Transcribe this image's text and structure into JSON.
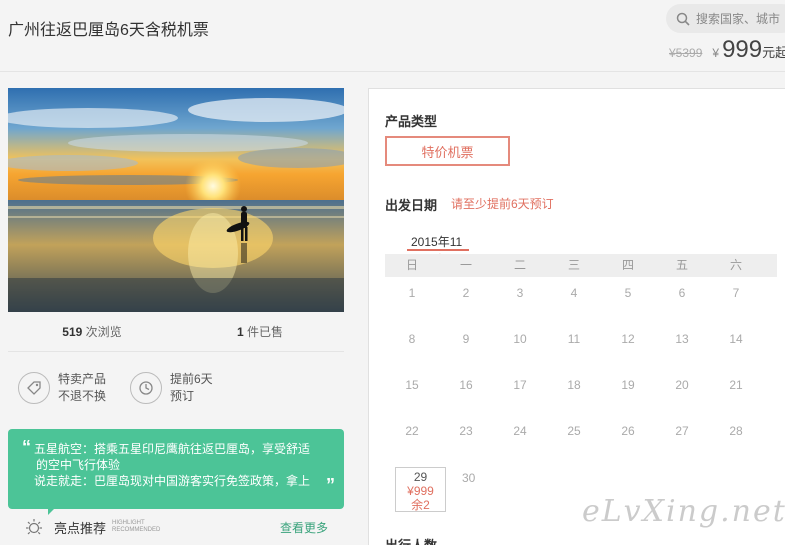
{
  "header": {
    "title": "广州往返巴厘岛6天含税机票",
    "search_placeholder": "搜索国家、城市",
    "old_price": "¥5399",
    "currency": "¥",
    "price": "999",
    "price_unit": "元起"
  },
  "stats": {
    "views_count": "519",
    "views_label": "次浏览",
    "sold_count": "1",
    "sold_label": "件已售"
  },
  "features": [
    {
      "icon": "tag-icon",
      "line1": "特卖产品",
      "line2": "不退不换"
    },
    {
      "icon": "clock-icon",
      "line1": "提前6天",
      "line2": "预订"
    }
  ],
  "highlight_box": {
    "quote_open": "“",
    "quote_close": "”",
    "line1": "五星航空：搭乘五星印尼鹰航往返巴厘岛，享受舒适",
    "line2": "的空中飞行体验",
    "line3": "说走就走：巴厘岛现对中国游客实行免签政策，拿上"
  },
  "highlight_footer": {
    "label": "亮点推荐",
    "en_line1": "HIGHLIGHT",
    "en_line2": "RECOMMENDED",
    "see_more": "查看更多"
  },
  "panel": {
    "product_type_label": "产品类型",
    "product_type_value": "特价机票",
    "departure_label": "出发日期",
    "departure_hint": "请至少提前6天预订",
    "month": "2015年11",
    "month_dot": "▲",
    "weekdays": [
      "日",
      "一",
      "二",
      "三",
      "四",
      "五",
      "六"
    ],
    "weeks": [
      [
        "1",
        "2",
        "3",
        "4",
        "5",
        "6",
        "7"
      ],
      [
        "8",
        "9",
        "10",
        "11",
        "12",
        "13",
        "14"
      ],
      [
        "15",
        "16",
        "17",
        "18",
        "19",
        "20",
        "21"
      ],
      [
        "22",
        "23",
        "24",
        "25",
        "26",
        "27",
        "28"
      ]
    ],
    "selected_day": {
      "day": "29",
      "price": "¥999",
      "remaining": "余2"
    },
    "last_day": "30",
    "travelers_label": "出行人数"
  },
  "watermark": "eLvXing.net",
  "colors": {
    "accent_red": "#e07060",
    "green": "#4cc497",
    "link_green": "#3aa37c"
  }
}
